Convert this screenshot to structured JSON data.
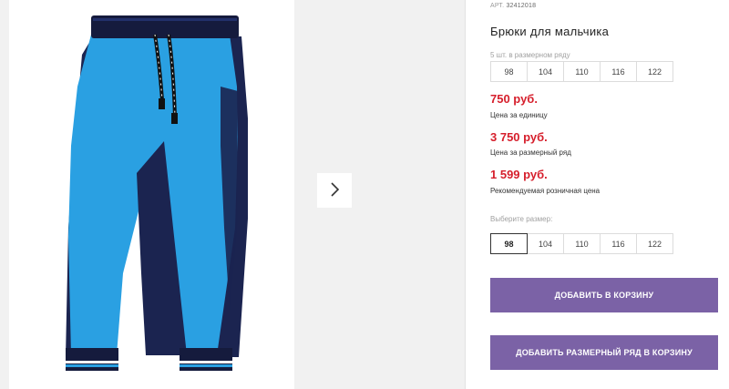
{
  "product": {
    "article_label": "АРТ.",
    "article_number": "32412018",
    "title": "Брюки для мальчика"
  },
  "pack": {
    "label": "5 шт. в размерном ряду",
    "sizes": [
      "98",
      "104",
      "110",
      "116",
      "122"
    ]
  },
  "prices": [
    {
      "value": "750 руб.",
      "caption": "Цена за единицу"
    },
    {
      "value": "3 750 руб.",
      "caption": "Цена за размерный ряд"
    },
    {
      "value": "1 599 руб.",
      "caption": "Рекомендуемая розничная цена"
    }
  ],
  "size_picker": {
    "label": "Выберите размер:",
    "options": [
      "98",
      "104",
      "110",
      "116",
      "122"
    ],
    "selected": "98"
  },
  "actions": {
    "add_to_cart": "ДОБАВИТЬ В КОРЗИНУ",
    "add_pack_to_cart": "ДОБАВИТЬ РАЗМЕРНЫЙ РЯД В КОРЗИНУ"
  },
  "gallery": {
    "next_icon": "chevron-right-icon"
  },
  "colors": {
    "price": "#d61f2c",
    "button": "#7b62a6",
    "pants_blue": "#2aa0e2",
    "pants_navy": "#1b2450"
  }
}
